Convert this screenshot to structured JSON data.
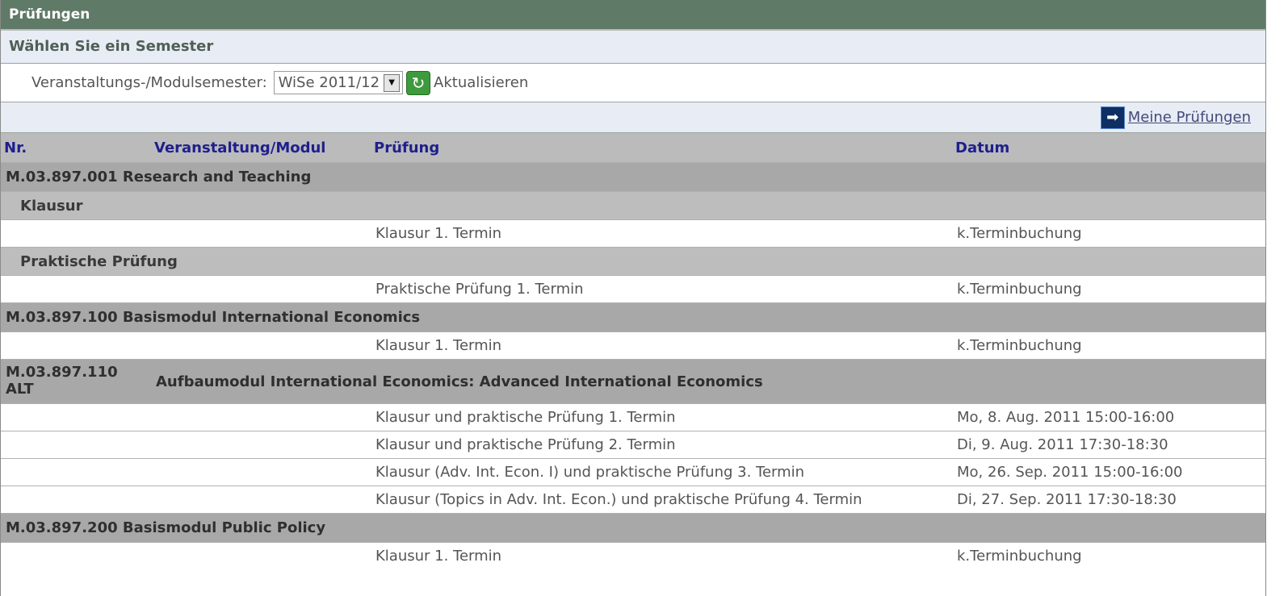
{
  "title": "Prüfungen",
  "subtitle": "Wählen Sie ein Semester",
  "semester": {
    "label": "Veranstaltungs-/Modulsemester:",
    "selected": "WiSe 2011/12",
    "refresh_label": "Aktualisieren"
  },
  "link": {
    "label": "Meine Prüfungen"
  },
  "table": {
    "headers": [
      "Nr.",
      "Veranstaltung/Modul",
      "Prüfung",
      "Datum"
    ],
    "rows": [
      {
        "type": "group",
        "text": "M.03.897.001 Research and Teaching"
      },
      {
        "type": "sub",
        "text": "Klausur"
      },
      {
        "type": "item",
        "exam": "Klausur 1. Termin",
        "date": "k.Terminbuchung"
      },
      {
        "type": "sub",
        "text": "Praktische Prüfung"
      },
      {
        "type": "item",
        "exam": "Praktische Prüfung 1. Termin",
        "date": "k.Terminbuchung"
      },
      {
        "type": "group",
        "text": "M.03.897.100 Basismodul International Economics"
      },
      {
        "type": "item",
        "exam": "Klausur 1. Termin",
        "date": "k.Terminbuchung"
      },
      {
        "type": "group2",
        "nr": "M.03.897.110 ALT",
        "text": "Aufbaumodul International Economics: Advanced International Economics"
      },
      {
        "type": "item",
        "exam": "Klausur und praktische Prüfung 1. Termin",
        "date": "Mo, 8. Aug. 2011 15:00-16:00"
      },
      {
        "type": "item",
        "exam": "Klausur und praktische Prüfung 2. Termin",
        "date": "Di, 9. Aug. 2011 17:30-18:30"
      },
      {
        "type": "item",
        "exam": "Klausur (Adv. Int. Econ. I) und praktische Prüfung 3. Termin",
        "date": "Mo, 26. Sep. 2011 15:00-16:00"
      },
      {
        "type": "item",
        "exam": "Klausur (Topics in Adv. Int. Econ.) und praktische Prüfung 4. Termin",
        "date": "Di, 27. Sep. 2011 17:30-18:30"
      },
      {
        "type": "group",
        "text": "M.03.897.200 Basismodul Public Policy"
      },
      {
        "type": "item",
        "exam": "Klausur 1. Termin",
        "date": "k.Terminbuchung"
      }
    ]
  }
}
